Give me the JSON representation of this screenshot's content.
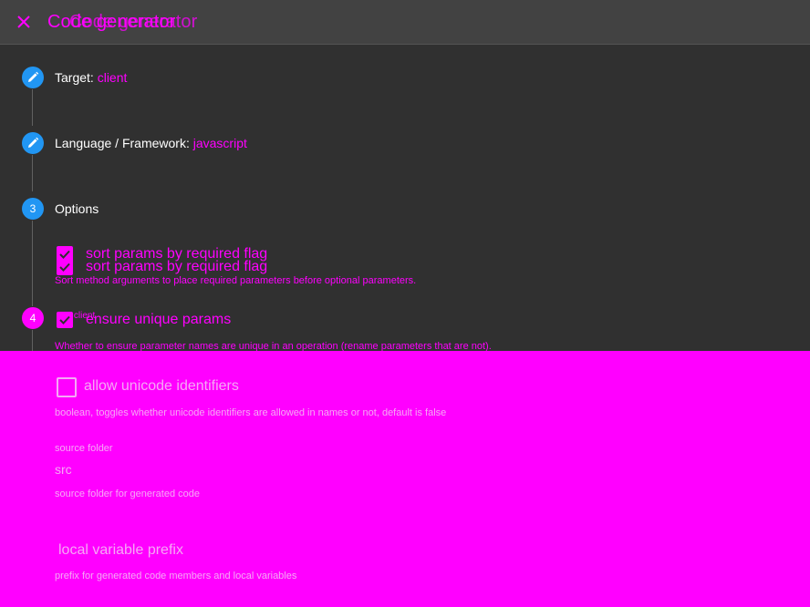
{
  "header": {
    "title": "Code generator",
    "title_ghost": "Code generator",
    "close_icon": "close-icon"
  },
  "steps": [
    {
      "index": "1",
      "icon": "pencil-icon",
      "label": "Target: ",
      "value": "client"
    },
    {
      "index": "2",
      "icon": "pencil-icon",
      "label": "Language / Framework: ",
      "value": "javascript"
    },
    {
      "index": "3",
      "label": "Options",
      "value": ""
    },
    {
      "index": "4",
      "label": "Get client",
      "value": ""
    }
  ],
  "options": [
    {
      "label": "sort params by required flag",
      "label_ghost": "sort params by required flag",
      "checked": true,
      "description": "Sort method arguments to place required parameters before optional parameters."
    },
    {
      "label": "ensure unique params",
      "checked": true,
      "description": "Whether to ensure parameter names are unique in an operation (rename parameters that are not)."
    },
    {
      "label": "allow unicode identifiers",
      "checked": false,
      "description": "boolean, toggles whether unicode identifiers are allowed in names or not, default is false"
    }
  ],
  "source_folder": {
    "label": "source folder",
    "value": "src",
    "hint": "source folder for generated code"
  },
  "local_variable_prefix": {
    "label": "local variable prefix",
    "hint": "prefix for generated code members and local variables"
  },
  "colors": {
    "accent": "#2196f3",
    "placeholder": "#ff00ff",
    "background": "#303030",
    "header": "#424242"
  }
}
